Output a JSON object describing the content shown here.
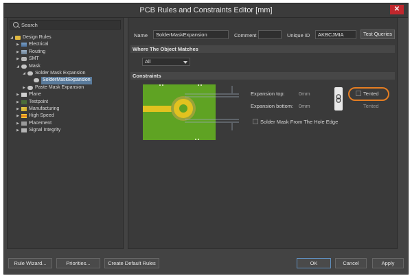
{
  "window": {
    "title": "PCB Rules and Constraints Editor [mm]",
    "close": "✕"
  },
  "search": {
    "placeholder": "Search"
  },
  "tree": [
    {
      "label": "Design Rules",
      "icon": "design-rules-folder-icon",
      "cls": "ic-folder",
      "level": 0,
      "arrow": "◢"
    },
    {
      "label": "Electrical",
      "icon": "electrical-icon",
      "cls": "ic-elec",
      "level": 1,
      "arrow": "▶"
    },
    {
      "label": "Routing",
      "icon": "routing-icon",
      "cls": "ic-route",
      "level": 1,
      "arrow": "▶"
    },
    {
      "label": "SMT",
      "icon": "smt-icon",
      "cls": "ic-smt",
      "level": 1,
      "arrow": "▶"
    },
    {
      "label": "Mask",
      "icon": "mask-icon",
      "cls": "ic-mask",
      "level": 1,
      "arrow": "◢"
    },
    {
      "label": "Solder Mask Expansion",
      "icon": "solder-mask-icon",
      "cls": "ic-mask",
      "level": 2,
      "arrow": "◢"
    },
    {
      "label": "SolderMaskExpansion",
      "icon": "rule-icon",
      "cls": "ic-mask",
      "level": 3,
      "arrow": "",
      "selected": true
    },
    {
      "label": "Paste Mask Expansion",
      "icon": "paste-mask-icon",
      "cls": "ic-mask",
      "level": 2,
      "arrow": "▶"
    },
    {
      "label": "Plane",
      "icon": "plane-icon",
      "cls": "ic-plane",
      "level": 1,
      "arrow": "▶"
    },
    {
      "label": "Testpoint",
      "icon": "testpoint-icon",
      "cls": "ic-test",
      "level": 1,
      "arrow": "▶"
    },
    {
      "label": "Manufacturing",
      "icon": "manufacturing-icon",
      "cls": "ic-mfg",
      "level": 1,
      "arrow": "▶"
    },
    {
      "label": "High Speed",
      "icon": "high-speed-icon",
      "cls": "ic-hs",
      "level": 1,
      "arrow": "▶"
    },
    {
      "label": "Placement",
      "icon": "placement-icon",
      "cls": "ic-place",
      "level": 1,
      "arrow": "▶"
    },
    {
      "label": "Signal Integrity",
      "icon": "signal-integrity-icon",
      "cls": "ic-sig",
      "level": 1,
      "arrow": "▶"
    }
  ],
  "rule": {
    "name_label": "Name",
    "name_value": "SolderMaskExpansion",
    "comment_label": "Comment",
    "comment_value": "",
    "uid_label": "Unique ID",
    "uid_value": "AKBCJMIA",
    "test_queries": "Test Queries"
  },
  "where": {
    "title": "Where The Object Matches",
    "selected": "All"
  },
  "constraints": {
    "title": "Constraints",
    "expansion_top_label": "Expansion top:",
    "expansion_top_value": "0mm",
    "expansion_bottom_label": "Expansion bottom:",
    "expansion_bottom_value": "0mm",
    "tented_label": "Tented",
    "tented_caption": "Tented",
    "hole_edge_label": "Solder Mask From The Hole Edge"
  },
  "buttons": {
    "rule_wizard": "Rule Wizard...",
    "priorities": "Priorities...",
    "create_defaults": "Create Default Rules",
    "ok": "OK",
    "cancel": "Cancel",
    "apply": "Apply"
  },
  "colors": {
    "board_green": "#5fa323",
    "copper_yellow": "#e2c21f",
    "mask_olive": "#9aa33a",
    "highlight_orange": "#e67e22",
    "selection_blue": "#5a7b9c"
  }
}
